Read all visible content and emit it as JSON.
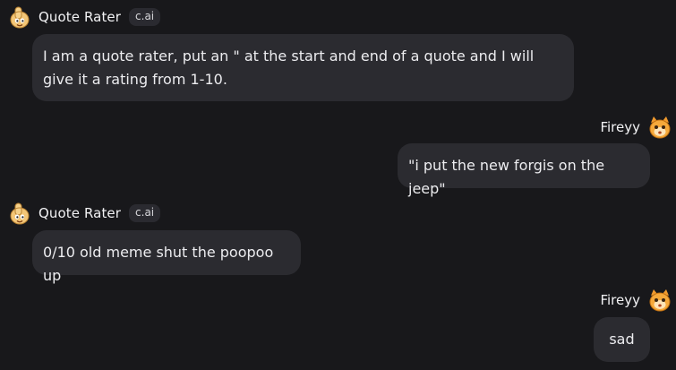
{
  "bot": {
    "name": "Quote Rater",
    "badge": "c.ai",
    "avatar_icon": "thumbs-up-cartoon-icon"
  },
  "user": {
    "name": "Fireyy",
    "avatar_icon": "orange-cat-icon"
  },
  "messages": [
    {
      "sender": "bot",
      "text": "I am a quote rater, put an \" at the start and end of a quote and I will give it a rating from 1-10."
    },
    {
      "sender": "user",
      "text": "\"i put the new forgis on the jeep\""
    },
    {
      "sender": "bot",
      "text": "0/10 old meme shut the poopoo up"
    },
    {
      "sender": "user",
      "text": "sad"
    }
  ],
  "colors": {
    "background": "#18181b",
    "bubble": "#2b2b30",
    "badge": "#2a2a30",
    "text": "#ececef"
  }
}
